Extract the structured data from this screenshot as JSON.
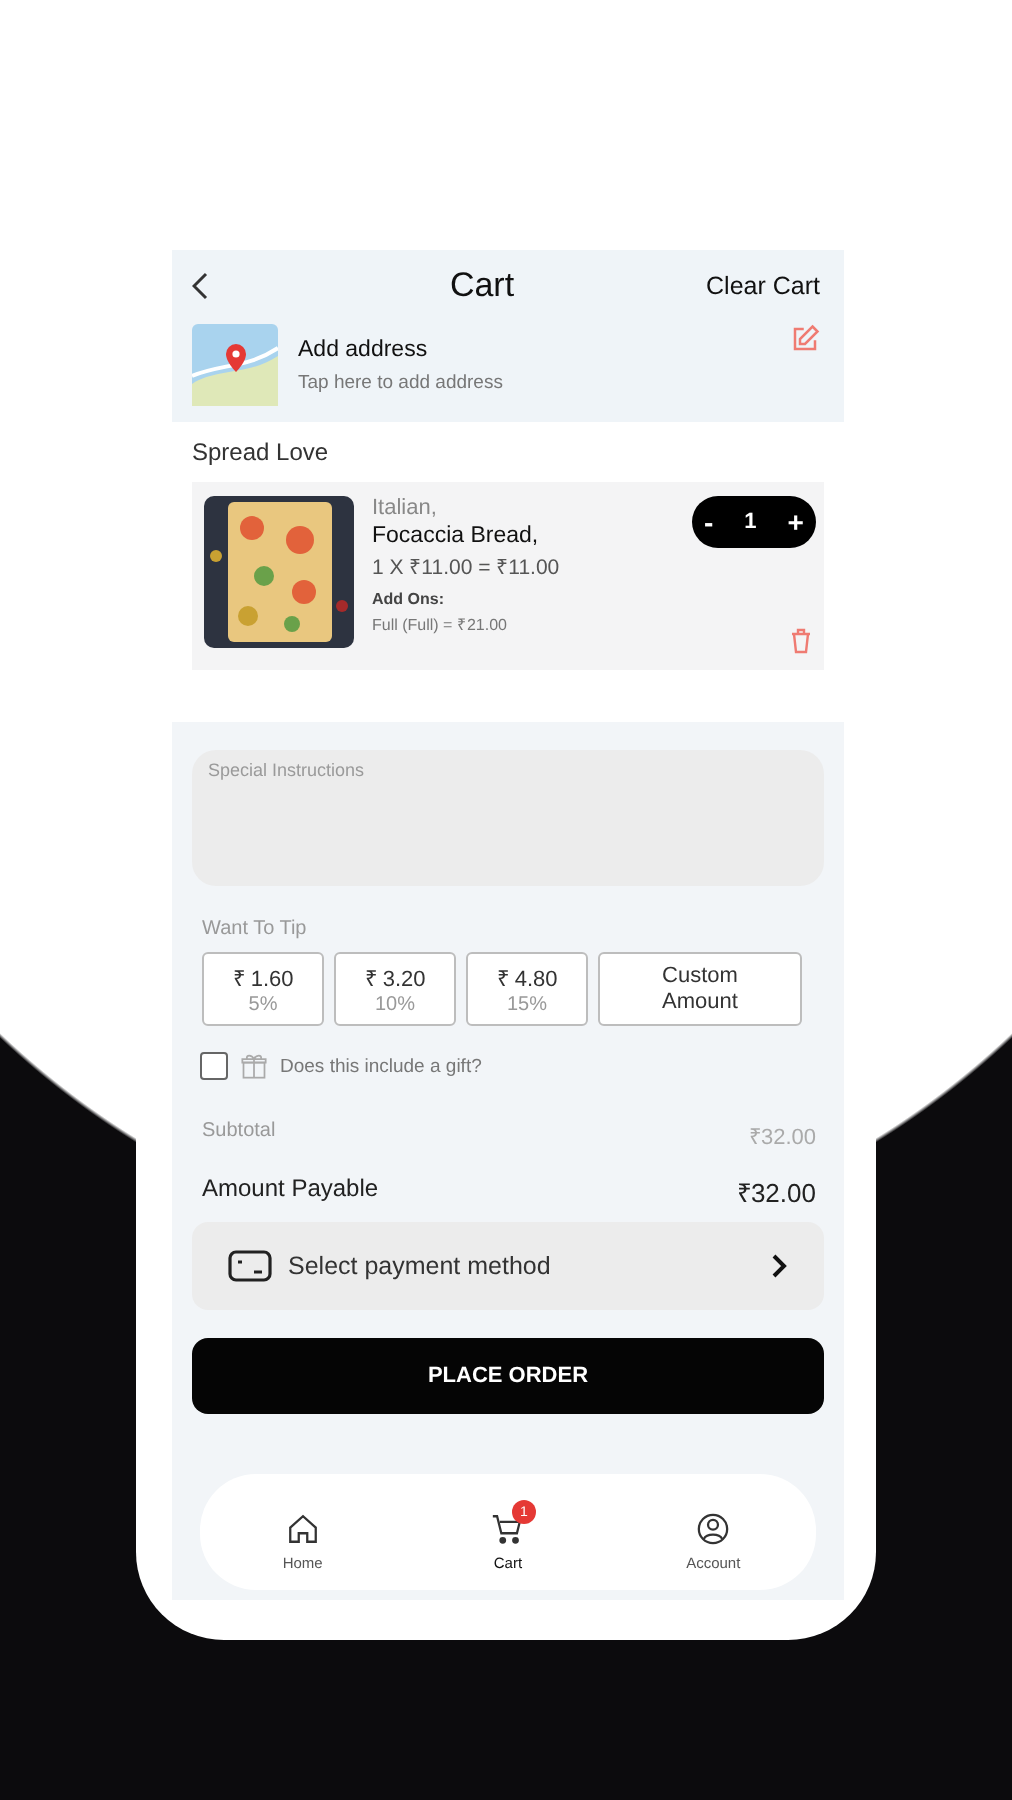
{
  "header": {
    "title": "Cart",
    "action": "Clear Cart"
  },
  "address": {
    "title": "Add address",
    "subtitle": "Tap here to add address"
  },
  "section_title": "Spread Love",
  "cart_items": [
    {
      "category": "Italian,",
      "name": "Focaccia Bread,",
      "price_line": "1 X ₹11.00 = ₹11.00",
      "addons_label": "Add Ons:",
      "addons": "Full (Full) = ₹21.00",
      "minus": "-",
      "quantity": "1",
      "plus": "+"
    }
  ],
  "instructions": {
    "placeholder": "Special Instructions"
  },
  "tip": {
    "label": "Want To Tip",
    "options": [
      {
        "amount": "₹ 1.60",
        "percent": "5%",
        "selected": false
      },
      {
        "amount": "₹ 3.20",
        "percent": "10%",
        "selected": false
      },
      {
        "amount": "₹ 4.80",
        "percent": "15%",
        "selected": false
      }
    ],
    "custom": "Custom Amount"
  },
  "gift": {
    "checked": false,
    "label": "Does this include a gift?"
  },
  "summary": [
    {
      "kind": "minor",
      "label": "Subtotal",
      "value": "₹32.00"
    },
    {
      "kind": "major",
      "label": "Amount Payable",
      "value": "₹32.00"
    }
  ],
  "payment": {
    "label": "Select payment method"
  },
  "place_order": "PLACE ORDER",
  "nav": [
    {
      "kind": "home",
      "label": "Home",
      "selected": false
    },
    {
      "kind": "cart",
      "label": "Cart",
      "selected": true,
      "badge": "1"
    },
    {
      "kind": "account",
      "label": "Account",
      "selected": false
    }
  ]
}
